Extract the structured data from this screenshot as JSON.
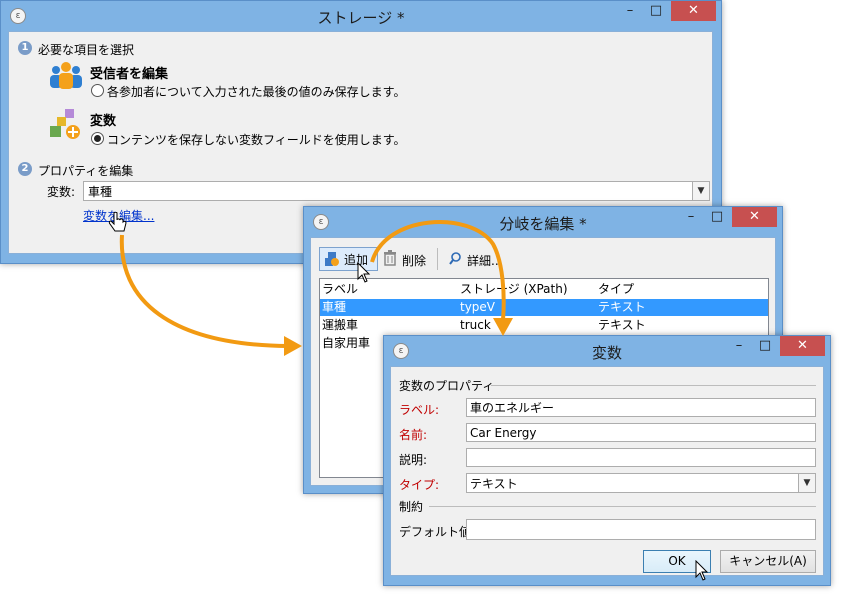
{
  "storage_window": {
    "title": "ストレージ *",
    "step1": {
      "number": "1",
      "label": "必要な項目を選択"
    },
    "option1": {
      "title": "受信者を編集",
      "radio_label": "各参加者について入力された最後の値のみ保存します。"
    },
    "option2": {
      "title": "変数",
      "radio_label": "コンテンツを保存しない変数フィールドを使用します。"
    },
    "step2": {
      "number": "2",
      "label": "プロパティを編集"
    },
    "variable_label": "変数:",
    "variable_value": "車種",
    "edit_variable_link": "変数を編集..."
  },
  "branch_window": {
    "title": "分岐を編集 *",
    "toolbar": {
      "add": "追加",
      "delete": "削除",
      "details": "詳細..."
    },
    "columns": {
      "label": "ラベル",
      "storage": "ストレージ (XPath)",
      "type": "タイプ"
    },
    "rows": [
      {
        "label": "車種",
        "storage": "typeV",
        "type": "テキスト"
      },
      {
        "label": "運搬車",
        "storage": "truck",
        "type": "テキスト"
      },
      {
        "label": "自家用車",
        "storage": "",
        "type": ""
      }
    ]
  },
  "variable_window": {
    "title": "変数",
    "section_properties": "変数のプロパティ",
    "label_label": "ラベル:",
    "label_value": "車のエネルギー",
    "name_label": "名前:",
    "name_value": "Car Energy",
    "description_label": "説明:",
    "description_value": "",
    "type_label": "タイプ:",
    "type_value": "テキスト",
    "section_constraints": "制約",
    "default_label": "デフォルト値:",
    "default_value": "",
    "ok_label": "OK",
    "cancel_label": "キャンセル(A)"
  },
  "colors": {
    "accent_arrow": "#f29a12",
    "selection": "#3399ff",
    "close_button": "#c75050",
    "required_label": "#c00000"
  },
  "icons": [
    "app-icon",
    "recipients-icon",
    "variable-icon",
    "add-icon",
    "trash-icon",
    "search-icon",
    "hand-cursor-icon",
    "arrow-cursor-icon",
    "close-icon",
    "minimize-icon",
    "maximize-icon"
  ]
}
